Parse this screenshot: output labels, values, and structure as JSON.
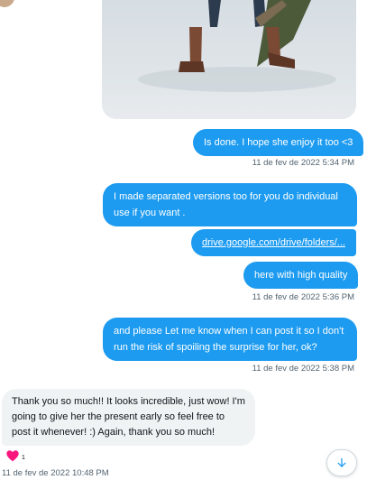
{
  "messages": {
    "sent": [
      {
        "text": "Is done. I hope she enjoy it too <3",
        "time": "11 de fev de 2022 5:34 PM"
      },
      {
        "text": "I made separated versions too for you do individual use if you want ."
      },
      {
        "text": "drive.google.com/drive/folders/..."
      },
      {
        "text": "here with high quality",
        "time": "11 de fev de 2022 5:36 PM"
      },
      {
        "text": "and please Let me know when I can post it so I don't run the risk of spoiling the surprise for her, ok?",
        "time": "11 de fev de 2022 5:38 PM"
      }
    ],
    "received": {
      "text": "Thank you so much!! It looks incredible, just wow! I'm going to give her the present early so feel free to post it whenever! :) Again, thank you so much!",
      "time": "11 de fev de 2022 10:48 PM",
      "reaction": {
        "icon": "heart-icon",
        "count": "1",
        "color": "#f91880"
      }
    }
  },
  "colors": {
    "sent_bubble": "#1d9bf0",
    "received_bubble": "#eff3f4",
    "accent": "#1d9bf0"
  },
  "scroll_button": {
    "icon": "arrow-down-icon"
  }
}
